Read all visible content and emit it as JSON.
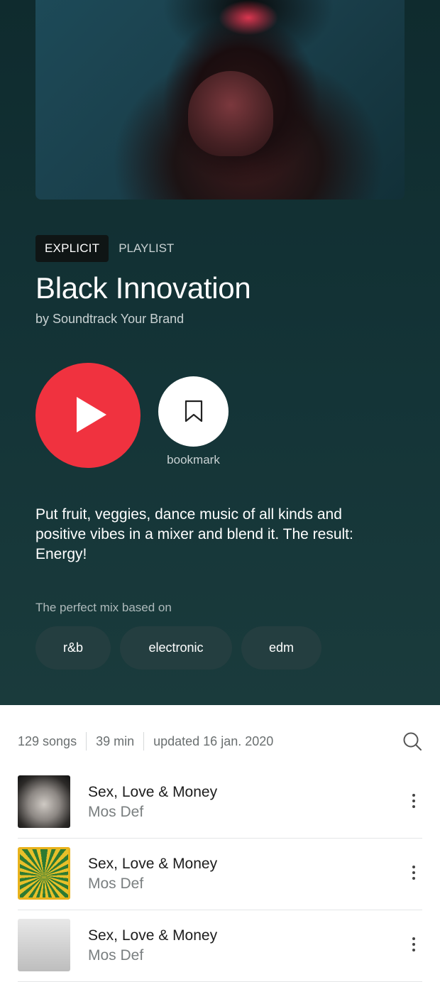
{
  "hero": {
    "badge_explicit": "EXPLICIT",
    "type_label": "PLAYLIST",
    "title": "Black Innovation",
    "byline": "by Soundtrack Your Brand",
    "bookmark_label": "bookmark",
    "description": "Put fruit, veggies, dance music of all kinds and positive vibes in a mixer and blend it. The result: Energy!",
    "mix_label": "The perfect mix based on",
    "genres": [
      "r&b",
      "electronic",
      "edm"
    ],
    "colors": {
      "background": "#143437",
      "play_button": "#f0323f",
      "chip": "#243e40"
    }
  },
  "meta": {
    "songs": "129 songs",
    "duration": "39 min",
    "updated": "updated 16 jan. 2020"
  },
  "tracks": [
    {
      "title": "Sex, Love & Money",
      "artist": "Mos Def"
    },
    {
      "title": "Sex, Love & Money",
      "artist": "Mos Def"
    },
    {
      "title": "Sex, Love & Money",
      "artist": "Mos Def"
    }
  ],
  "icons": {
    "play": "play-icon",
    "bookmark": "bookmark-icon",
    "search": "search-icon",
    "more": "more-vertical-icon"
  }
}
